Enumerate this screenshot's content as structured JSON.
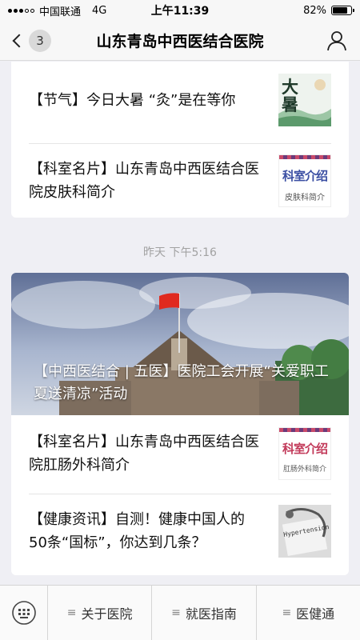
{
  "status_bar": {
    "carrier": "中国联通",
    "network": "4G",
    "time": "上午11:39",
    "battery_text": "82%",
    "battery_level": 0.82
  },
  "nav": {
    "back_badge": "3",
    "title": "山东青岛中西医结合医院",
    "back_icon": "chevron-left-icon",
    "profile_icon": "person-icon"
  },
  "group1": {
    "articles": [
      {
        "title": "【节气】今日大暑 “灸”是在等你",
        "thumb_text": "大暑"
      },
      {
        "title": "【科室名片】山东青岛中西医结合医院皮肤科简介",
        "thumb_title": "科室介绍",
        "thumb_sub": "皮肤科简介"
      }
    ]
  },
  "timestamp": "昨天 下午5:16",
  "group2": {
    "cover_title": "【中西医结合 | 五医】医院工会开展“关爱职工 夏送清凉”活动",
    "articles": [
      {
        "title": "【科室名片】山东青岛中西医结合医院肛肠外科简介",
        "thumb_title": "科室介绍",
        "thumb_sub": "肛肠外科简介"
      },
      {
        "title": "【健康资讯】自测！健康中国人的50条“国标”，你达到几条？",
        "thumb_text": "Hypertension"
      }
    ]
  },
  "bottom_menu": {
    "keyboard_icon": "keyboard-icon",
    "items": [
      {
        "label": "关于医院"
      },
      {
        "label": "就医指南"
      },
      {
        "label": "医健通"
      }
    ]
  },
  "colors": {
    "background": "#efeff4",
    "card": "#ffffff",
    "timestamp": "#a2a2a2"
  }
}
